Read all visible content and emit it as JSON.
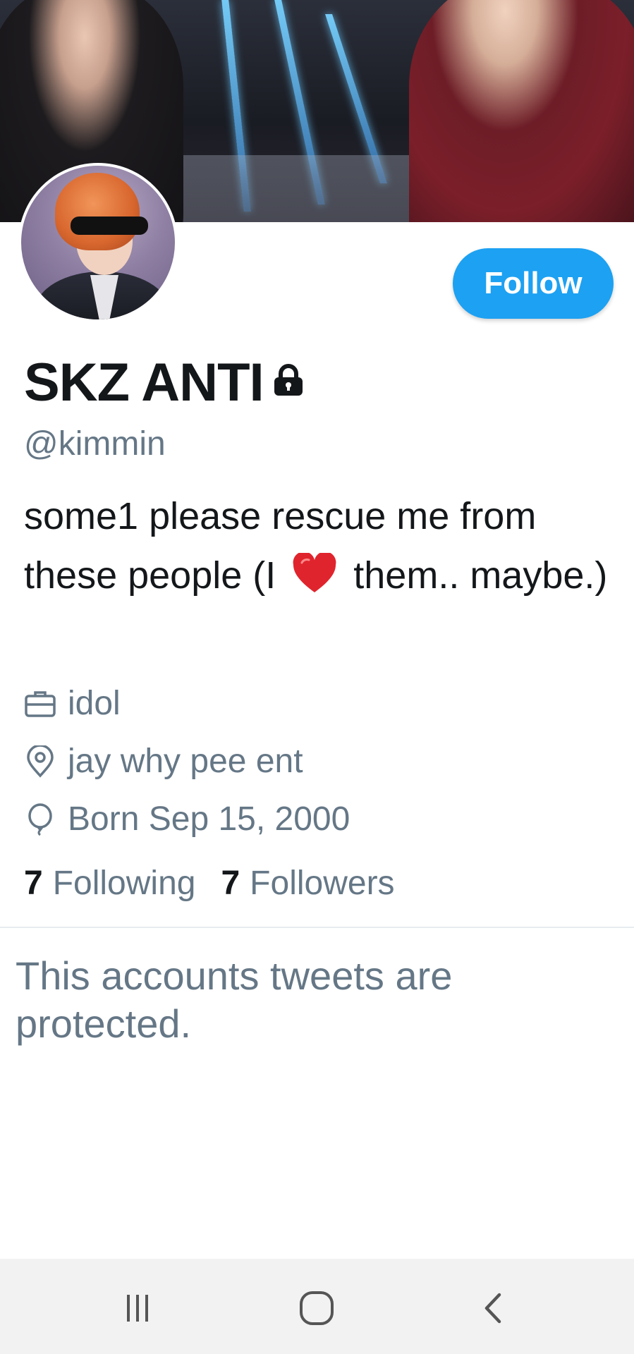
{
  "profile": {
    "display_name": "SKZ ANTI",
    "handle": "@kimmin",
    "bio_before": "some1 please rescue me from these people (I",
    "bio_after": "them.. maybe.)",
    "bio_emoji": "heart-icon",
    "follow_label": "Follow",
    "occupation": "idol",
    "location": "jay why pee ent",
    "born": "Born Sep 15, 2000"
  },
  "stats": {
    "following_count": "7",
    "following_label": "Following",
    "followers_count": "7",
    "followers_label": "Followers"
  },
  "protected_message": "This accounts tweets are protected.",
  "icons": {
    "lock": "lock-icon",
    "occupation": "briefcase-icon",
    "location": "location-pin-icon",
    "born": "balloon-icon",
    "nav_recent": "recent-apps-icon",
    "nav_home": "home-icon",
    "nav_back": "back-icon"
  },
  "colors": {
    "accent": "#1da1f2",
    "text_primary": "#14171a",
    "text_secondary": "#657786",
    "divider": "#e6ecf0",
    "heart": "#e0242d"
  }
}
